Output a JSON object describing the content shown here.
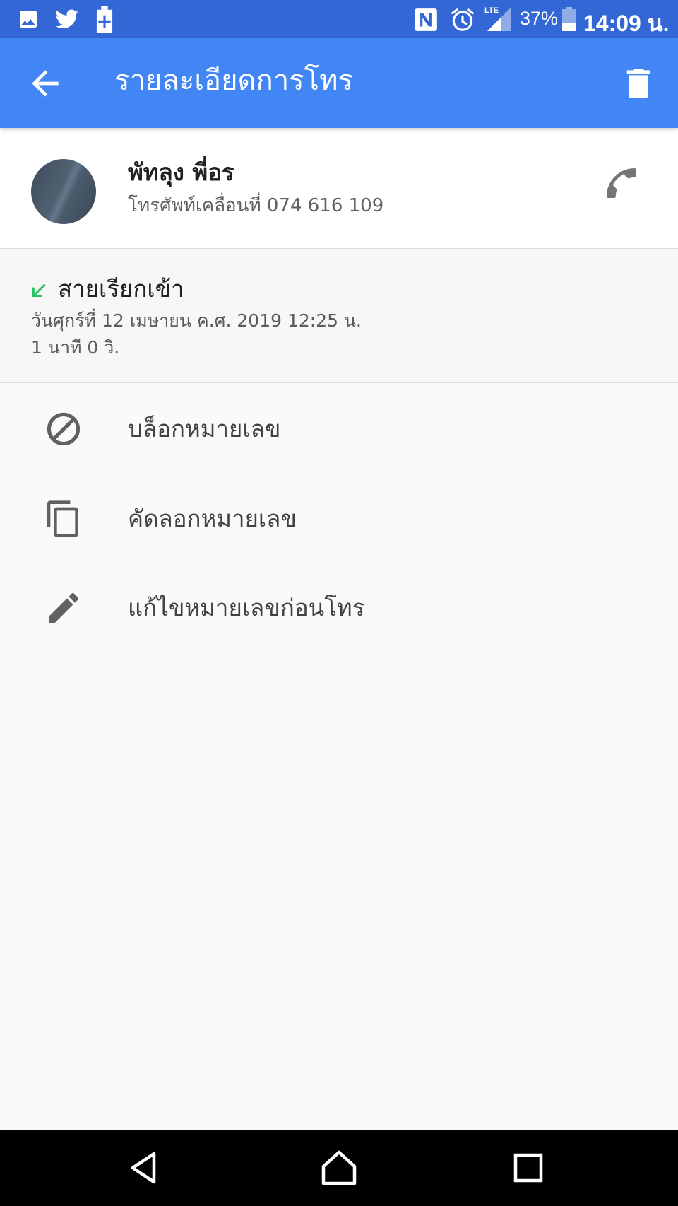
{
  "status_bar": {
    "left_icons": [
      "image-icon",
      "twitter-icon",
      "battery-saver-icon"
    ],
    "right_icons": [
      "nfc-icon",
      "alarm-icon",
      "lte-signal-icon",
      "battery-icon"
    ],
    "network": "LTE",
    "battery": "37%",
    "time": "14:09 น."
  },
  "app_bar": {
    "title": "รายละเอียดการโทร",
    "back_icon": "arrow-back-icon",
    "delete_icon": "trash-icon",
    "background": "#4285f4",
    "status_background": "#3367d6"
  },
  "contact": {
    "name": "พัทลุง พี่อร",
    "number": "โทรศัพท์เคลื่อนที่ 074 616 109",
    "call_icon": "phone-icon"
  },
  "call_details": {
    "type": "สายเรียกเข้า",
    "type_icon": "incoming-call-arrow-icon",
    "type_icon_color": "#22c55e",
    "date": "วันศุกร์ที่ 12 เมษายน ค.ศ. 2019 12:25 น.",
    "duration": "1 นาที 0 วิ."
  },
  "actions": [
    {
      "label": "บล็อกหมายเลข",
      "icon": "block-icon"
    },
    {
      "label": "คัดลอกหมายเลข",
      "icon": "copy-icon"
    },
    {
      "label": "แก้ไขหมายเลขก่อนโทร",
      "icon": "edit-pencil-icon"
    }
  ],
  "nav_bar": {
    "buttons": [
      "back-triangle-icon",
      "home-icon",
      "recents-icon"
    ]
  }
}
